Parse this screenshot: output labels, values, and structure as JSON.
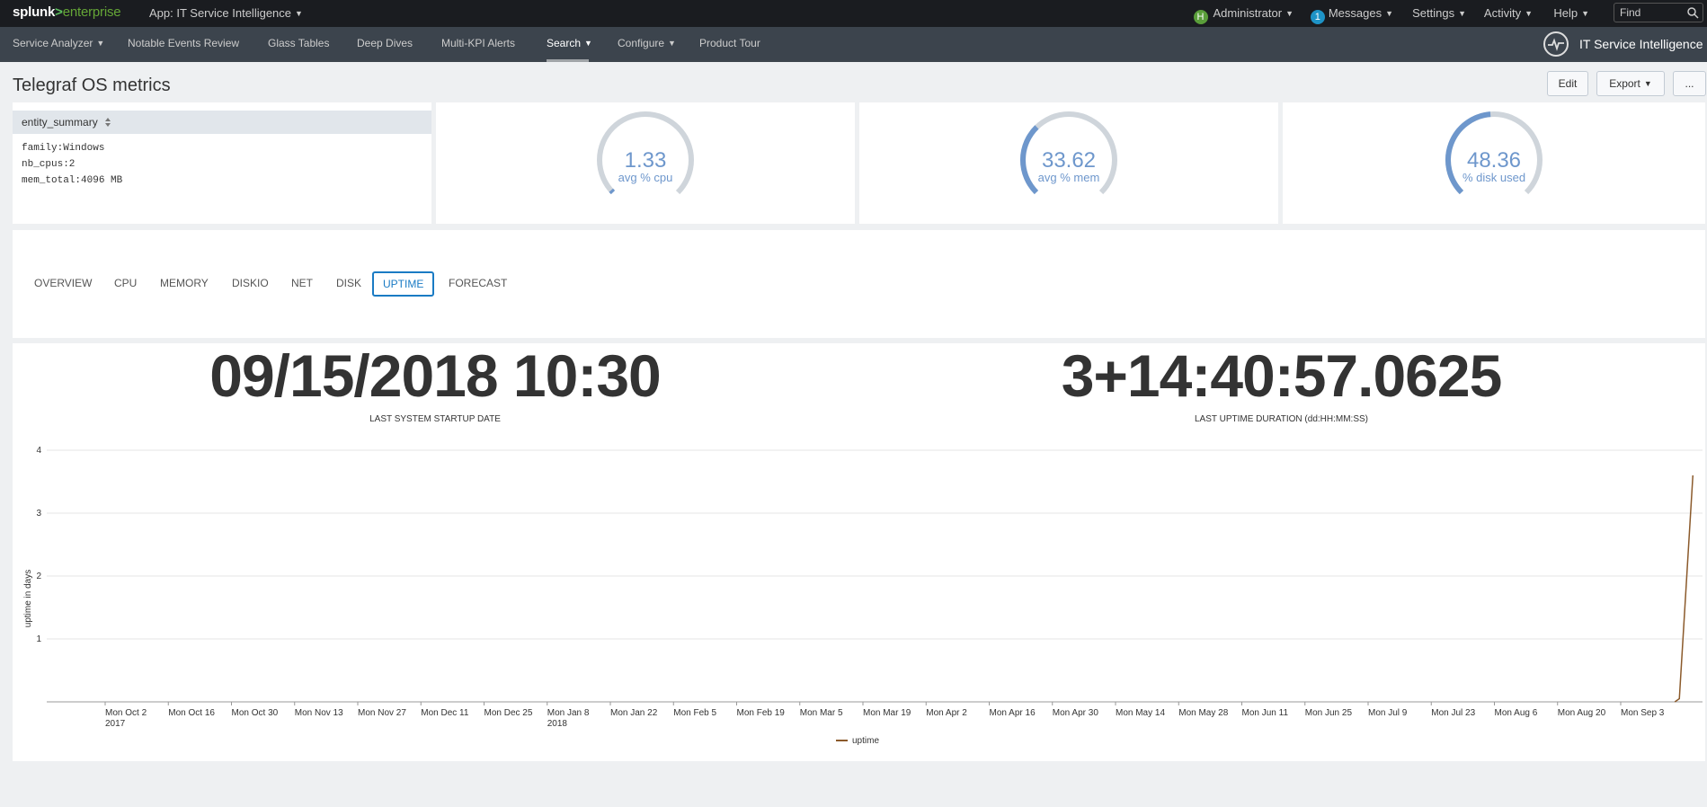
{
  "topbar": {
    "brand_splunk": "splunk",
    "brand_gt": ">",
    "brand_enterprise": "enterprise",
    "app_label": "App: IT Service Intelligence",
    "avatar_letter": "H",
    "user_label": "Administrator",
    "messages_count": "1",
    "messages_label": "Messages",
    "settings_label": "Settings",
    "activity_label": "Activity",
    "help_label": "Help",
    "find_placeholder": "Find"
  },
  "nav": {
    "items": [
      {
        "label": "Service Analyzer",
        "has_caret": true
      },
      {
        "label": "Notable Events Review",
        "has_caret": false
      },
      {
        "label": "Glass Tables",
        "has_caret": false
      },
      {
        "label": "Deep Dives",
        "has_caret": false
      },
      {
        "label": "Multi-KPI Alerts",
        "has_caret": false
      },
      {
        "label": "Search",
        "has_caret": true,
        "active": true
      },
      {
        "label": "Configure",
        "has_caret": true
      },
      {
        "label": "Product Tour",
        "has_caret": false
      }
    ],
    "app_title": "IT Service Intelligence"
  },
  "dashboard": {
    "title": "Telegraf OS metrics",
    "edit_label": "Edit",
    "export_label": "Export",
    "more_label": "..."
  },
  "summary": {
    "header": "entity_summary",
    "lines": [
      "family:Windows",
      "nb_cpus:2",
      "mem_total:4096 MB"
    ]
  },
  "gauges": [
    {
      "value": "1.33",
      "label": "avg % cpu",
      "fraction": 0.0133
    },
    {
      "value": "33.62",
      "label": "avg % mem",
      "fraction": 0.3362
    },
    {
      "value": "48.36",
      "label": "% disk used",
      "fraction": 0.4836
    }
  ],
  "colors": {
    "gauge_fill": "#6e97cc",
    "gauge_track": "#cfd5db",
    "series_uptime": "#8b5a2b",
    "tab_selected": "#1a7bc4"
  },
  "tabs": [
    {
      "label": "OVERVIEW"
    },
    {
      "label": "CPU"
    },
    {
      "label": "MEMORY"
    },
    {
      "label": "DISKIO"
    },
    {
      "label": "NET"
    },
    {
      "label": "DISK"
    },
    {
      "label": "UPTIME",
      "selected": true
    },
    {
      "label": "FORECAST"
    }
  ],
  "singles": [
    {
      "value": "09/15/2018 10:30",
      "label": "LAST SYSTEM STARTUP DATE"
    },
    {
      "value": "3+14:40:57.0625",
      "label": "LAST UPTIME DURATION (dd:HH:MM:SS)"
    }
  ],
  "chart_data": {
    "type": "line",
    "ylabel": "uptime in days",
    "ylim": [
      0,
      4
    ],
    "yticks": [
      "1",
      "2",
      "3",
      "4"
    ],
    "x_tick_labels": [
      [
        "Mon Oct 2",
        "2017"
      ],
      [
        "Mon Oct 16"
      ],
      [
        "Mon Oct 30"
      ],
      [
        "Mon Nov 13"
      ],
      [
        "Mon Nov 27"
      ],
      [
        "Mon Dec 11"
      ],
      [
        "Mon Dec 25"
      ],
      [
        "Mon Jan 8",
        "2018"
      ],
      [
        "Mon Jan 22"
      ],
      [
        "Mon Feb 5"
      ],
      [
        "Mon Feb 19"
      ],
      [
        "Mon Mar 5"
      ],
      [
        "Mon Mar 19"
      ],
      [
        "Mon Apr 2"
      ],
      [
        "Mon Apr 16"
      ],
      [
        "Mon Apr 30"
      ],
      [
        "Mon May 14"
      ],
      [
        "Mon May 28"
      ],
      [
        "Mon Jun 11"
      ],
      [
        "Mon Jun 25"
      ],
      [
        "Mon Jul 9"
      ],
      [
        "Mon Jul 23"
      ],
      [
        "Mon Aug 6"
      ],
      [
        "Mon Aug 20"
      ],
      [
        "Mon Sep 3"
      ]
    ],
    "series": [
      {
        "name": "uptime",
        "points": [
          {
            "x": "2018-09-15",
            "y": 0
          },
          {
            "x": "2018-09-16",
            "y": 0.05
          },
          {
            "x": "2018-09-19",
            "y": 3.6
          }
        ]
      }
    ],
    "legend": "bottom",
    "grid": true
  }
}
